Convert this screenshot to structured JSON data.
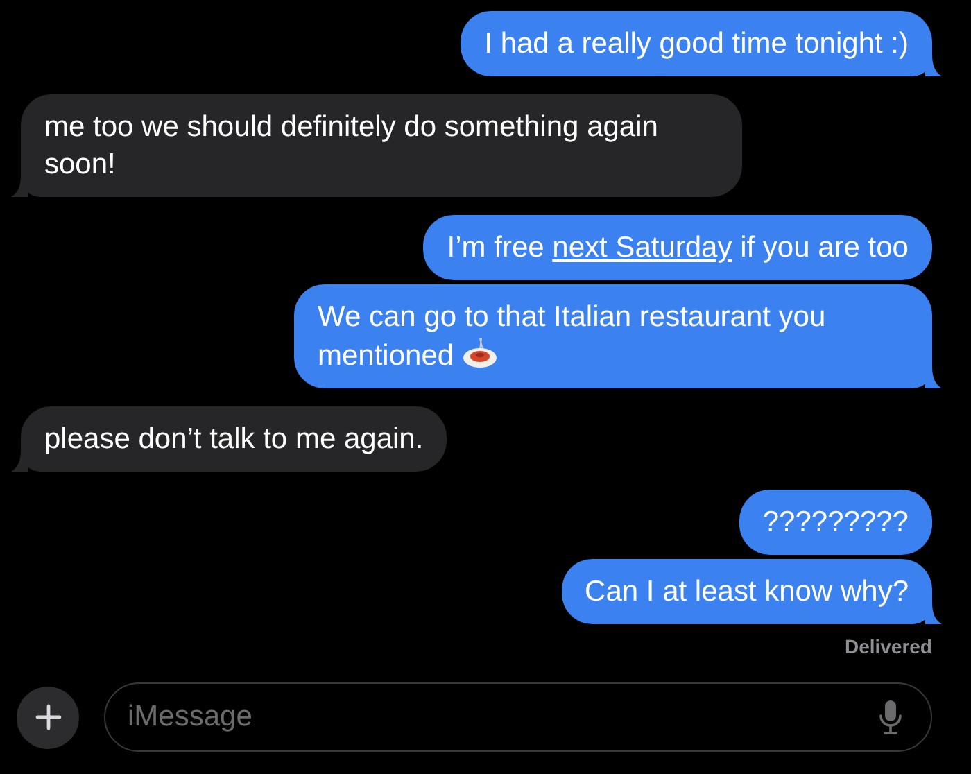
{
  "messages": [
    {
      "kind": "sent",
      "tail": true,
      "parts": [
        {
          "kind": "text",
          "text": "I had a really good time tonight :)"
        }
      ]
    },
    {
      "kind": "received",
      "tail": true,
      "parts": [
        {
          "kind": "text",
          "text": "me too we should definitely do something again soon!"
        }
      ]
    },
    {
      "kind": "sent",
      "tail": false,
      "parts": [
        {
          "kind": "text",
          "text": "I’m free "
        },
        {
          "kind": "link",
          "text": "next Saturday"
        },
        {
          "kind": "text",
          "text": " if you are too"
        }
      ]
    },
    {
      "kind": "sent",
      "tail": true,
      "parts": [
        {
          "kind": "text",
          "text": "We can go to that Italian restaurant you mentioned"
        },
        {
          "kind": "emoji"
        }
      ]
    },
    {
      "kind": "received",
      "tail": true,
      "parts": [
        {
          "kind": "text",
          "text": "please don’t talk to me again."
        }
      ]
    },
    {
      "kind": "sent",
      "tail": false,
      "parts": [
        {
          "kind": "text",
          "text": "?????????"
        }
      ]
    },
    {
      "kind": "sent",
      "tail": true,
      "parts": [
        {
          "kind": "text",
          "text": "Can I at least know why?"
        }
      ]
    }
  ],
  "status": "Delivered",
  "composer": {
    "placeholder": "iMessage"
  }
}
